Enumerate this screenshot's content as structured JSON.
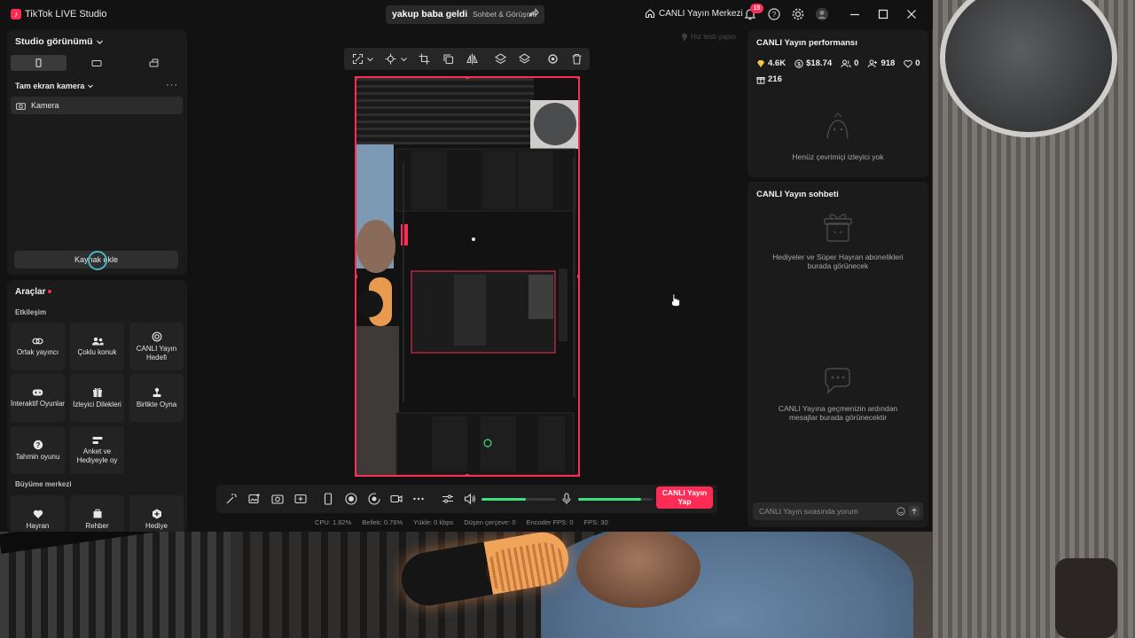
{
  "titlebar": {
    "app_title": "TikTok LIVE Studio",
    "stream_title": "yakup baba geldi",
    "stream_category": "Sohbet & Görüşme",
    "center_label": "CANLI Yayın Merkezi",
    "notification_count": "15"
  },
  "left": {
    "studio_view_label": "Studio görünümü",
    "scene_label": "Tam ekran kamera",
    "more_label": "···",
    "source_name": "Kamera",
    "add_source_label": "Kaynak ekle",
    "tools_title": "Araçlar",
    "sections": {
      "interaction": "Etkileşim",
      "growth": "Büyüme merkezi"
    },
    "tools": [
      {
        "label": "Ortak yayıncı",
        "icon": "link-icon"
      },
      {
        "label": "Çoklu konuk",
        "icon": "users-icon"
      },
      {
        "label": "CANLI Yayın Hedefi",
        "icon": "target-icon"
      },
      {
        "label": "İnteraktif Oyunlar",
        "icon": "gamepad-icon"
      },
      {
        "label": "İzleyici Dilekleri",
        "icon": "gift-icon"
      },
      {
        "label": "Birlikte Oyna",
        "icon": "joystick-icon"
      },
      {
        "label": "Tahmin oyunu",
        "icon": "question-icon"
      },
      {
        "label": "Anket ve Hediyeyle oy",
        "icon": "poll-icon"
      }
    ],
    "growth_tools": [
      {
        "label": "Hayran",
        "icon": "heart-shield-icon"
      },
      {
        "label": "Rehber",
        "icon": "guide-icon"
      },
      {
        "label": "Hediye",
        "icon": "gift-badge-icon"
      }
    ]
  },
  "center": {
    "test_speed_label": "Hız testi yapın",
    "go_live_label": "CANLI Yayın Yap",
    "volume_level": 0.6,
    "mic_level": 0.85,
    "stats": {
      "cpu": "CPU:  1.82%",
      "memory": "Bellek:  0.76%",
      "upload": "Yükle:  0 kbps",
      "dropped": "Düşen çerçeve:  0",
      "encoder_fps": "Encoder FPS:  0",
      "fps": "FPS:  30"
    }
  },
  "right": {
    "perf_title": "CANLI Yayın performansı",
    "metrics": [
      {
        "icon": "diamond-icon",
        "value": "4.6K"
      },
      {
        "icon": "dollar-icon",
        "value": "$18.74"
      },
      {
        "icon": "viewers-icon",
        "value": "0"
      },
      {
        "icon": "followers-icon",
        "value": "918"
      },
      {
        "icon": "heart-icon",
        "value": "0"
      },
      {
        "icon": "gift-icon",
        "value": "216"
      }
    ],
    "no_viewers": "Henüz çevrimiçi izleyici yok",
    "chat_title": "CANLI Yayın sohbeti",
    "gifts_text": "Hediyeler ve Süper Hayran abonelikleri burada görünecek",
    "messages_text": "CANLI Yayına geçmenizin ardından mesajlar burada görünecektir",
    "chat_placeholder": "CANLI Yayın sırasında yorum"
  },
  "colors": {
    "accent": "#fe2c55",
    "level": "#3ce07e",
    "panel": "#1b1b1b",
    "app_bg": "#121212"
  }
}
